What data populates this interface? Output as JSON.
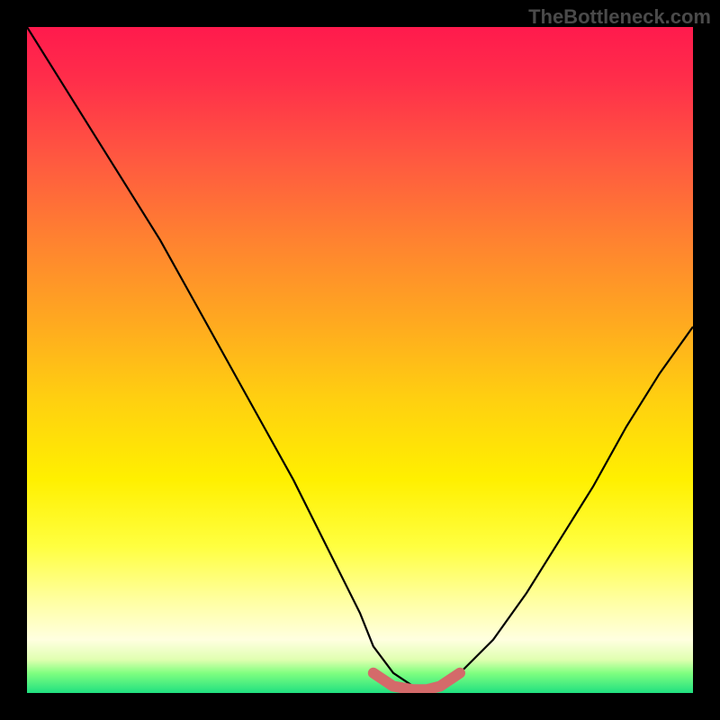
{
  "attribution": "TheBottleneck.com",
  "chart_data": {
    "type": "line",
    "title": "",
    "xlabel": "",
    "ylabel": "",
    "xlim": [
      0,
      100
    ],
    "ylim": [
      0,
      100
    ],
    "background_gradient": {
      "stops": [
        {
          "pos": 0.0,
          "color": "#ff1a4d"
        },
        {
          "pos": 0.5,
          "color": "#ffe000"
        },
        {
          "pos": 0.95,
          "color": "#ffff90"
        },
        {
          "pos": 1.0,
          "color": "#20e080"
        }
      ]
    },
    "series": [
      {
        "name": "bottleneck-curve",
        "color": "#000000",
        "x": [
          0,
          5,
          10,
          15,
          20,
          25,
          30,
          35,
          40,
          45,
          50,
          52,
          55,
          58,
          60,
          62,
          65,
          70,
          75,
          80,
          85,
          90,
          95,
          100
        ],
        "y": [
          100,
          92,
          84,
          76,
          68,
          59,
          50,
          41,
          32,
          22,
          12,
          7,
          3,
          1,
          0,
          1,
          3,
          8,
          15,
          23,
          31,
          40,
          48,
          55
        ]
      },
      {
        "name": "optimal-range-marker",
        "color": "#d46a6a",
        "x": [
          52,
          55,
          58,
          60,
          62,
          65
        ],
        "y": [
          3,
          1,
          0.5,
          0.5,
          1,
          3
        ]
      }
    ],
    "optimal_range": {
      "x_start": 52,
      "x_end": 65
    }
  }
}
